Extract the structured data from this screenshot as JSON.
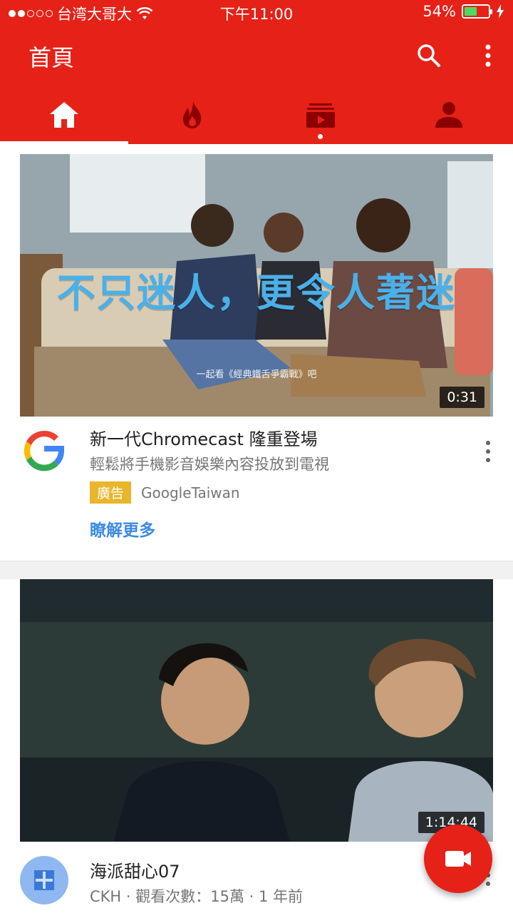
{
  "status_bar": {
    "carrier": "台湾大哥大",
    "time": "下午11:00",
    "battery": "54%",
    "battery_level": 0.54,
    "signal_icon": "signal-dots-icon",
    "wifi_icon": "wifi-icon",
    "charging_icon": "charging-bolt-icon"
  },
  "app_bar": {
    "title": "首頁",
    "search_icon": "search-icon",
    "more_icon": "more-vert-icon"
  },
  "tabs": [
    {
      "name": "home",
      "icon": "home-icon",
      "selected": true
    },
    {
      "name": "trending",
      "icon": "flame-icon",
      "selected": false
    },
    {
      "name": "subscriptions",
      "icon": "subscriptions-icon",
      "selected": false,
      "has_notification": true
    },
    {
      "name": "account",
      "icon": "account-icon",
      "selected": false
    }
  ],
  "feed": {
    "items": [
      {
        "type": "ad",
        "thumbnail_overlay": "不只迷人，更令人著迷",
        "thumbnail_caption": "一起看《經典鐵舌爭霸戰》吧",
        "duration": "0:31",
        "title": "新一代Chromecast 隆重登場",
        "subtitle": "輕鬆將手機影音娛樂內容投放到電視",
        "ad_badge": "廣告",
        "channel": "GoogleTaiwan",
        "cta": "瞭解更多",
        "avatar_icon": "google-logo-icon"
      },
      {
        "type": "video",
        "duration": "1:14:44",
        "title": "海派甜心07",
        "meta": "CKH · 觀看次數：15萬 · 1 年前",
        "avatar_icon": "channel-avatar-icon"
      }
    ]
  },
  "fab": {
    "icon": "video-camera-icon"
  },
  "colors": {
    "brand_red": "#e62117",
    "ad_badge": "#e9b52a",
    "link_blue": "#3c8be0"
  }
}
